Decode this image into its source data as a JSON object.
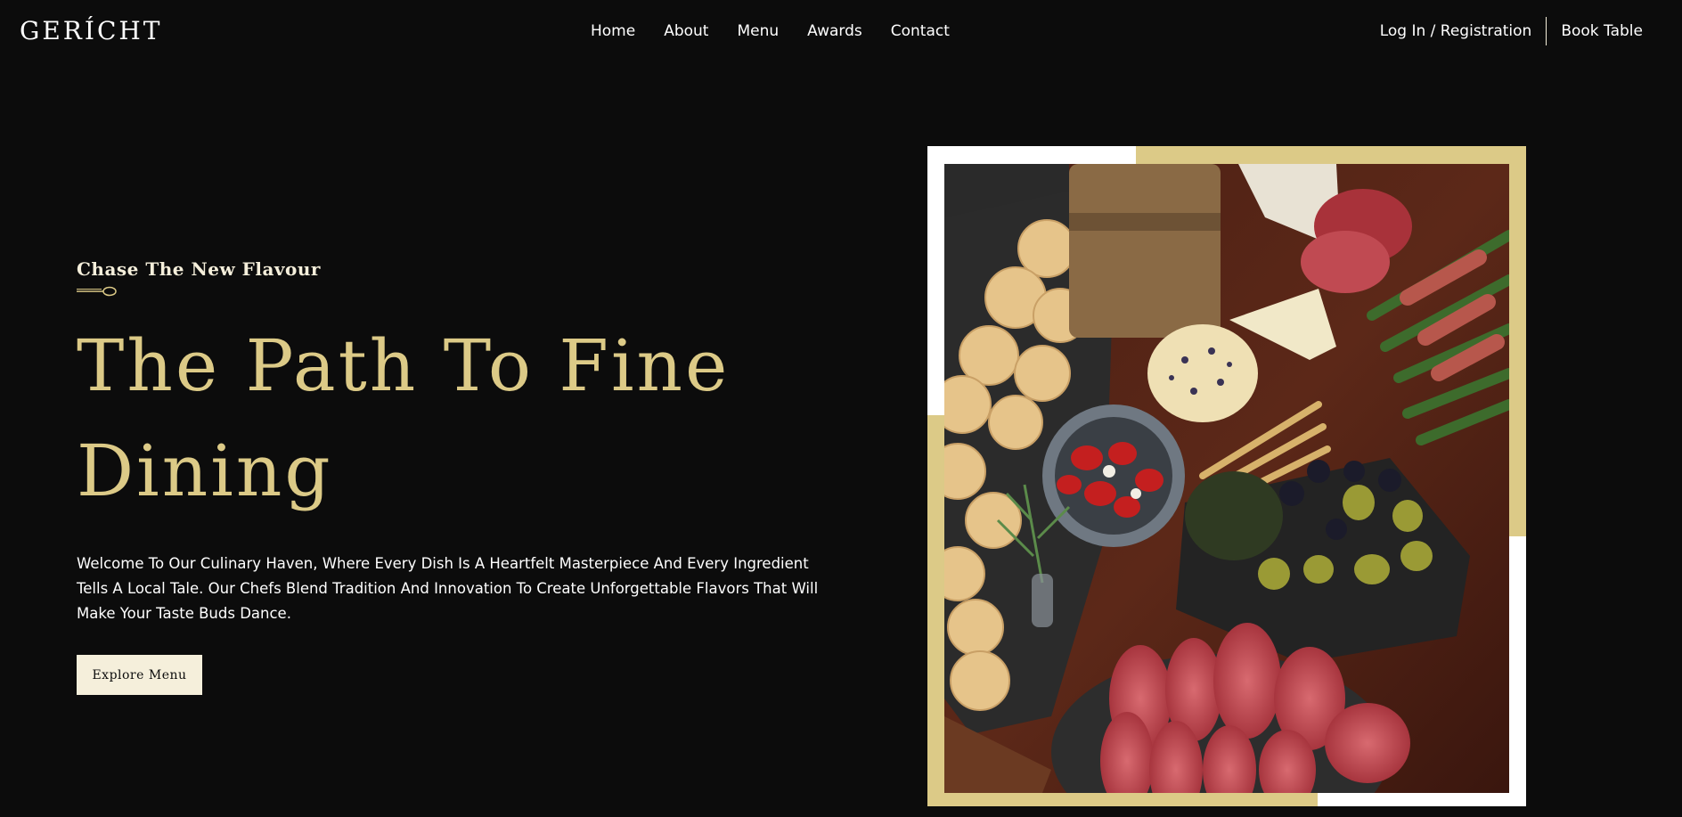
{
  "logo": "GERÍCHT",
  "nav": {
    "links": [
      "Home",
      "About",
      "Menu",
      "Awards",
      "Contact"
    ],
    "login": "Log In / Registration",
    "book": "Book Table"
  },
  "hero": {
    "subtitle": "Chase The New Flavour",
    "headline": "The Path To Fine Dining",
    "description": "Welcome To Our Culinary Haven, Where Every Dish Is A Heartfelt Masterpiece And Every Ingredient Tells A Local Tale. Our Chefs Blend Tradition And Innovation To Create Unforgettable Flavors That Will Make Your Taste Buds Dance.",
    "button": "Explore Menu"
  },
  "colors": {
    "background": "#0c0c0c",
    "gold": "#dcca87",
    "cream": "#f5efdb",
    "white": "#ffffff"
  },
  "icons": {
    "divider": "spoon-icon"
  }
}
